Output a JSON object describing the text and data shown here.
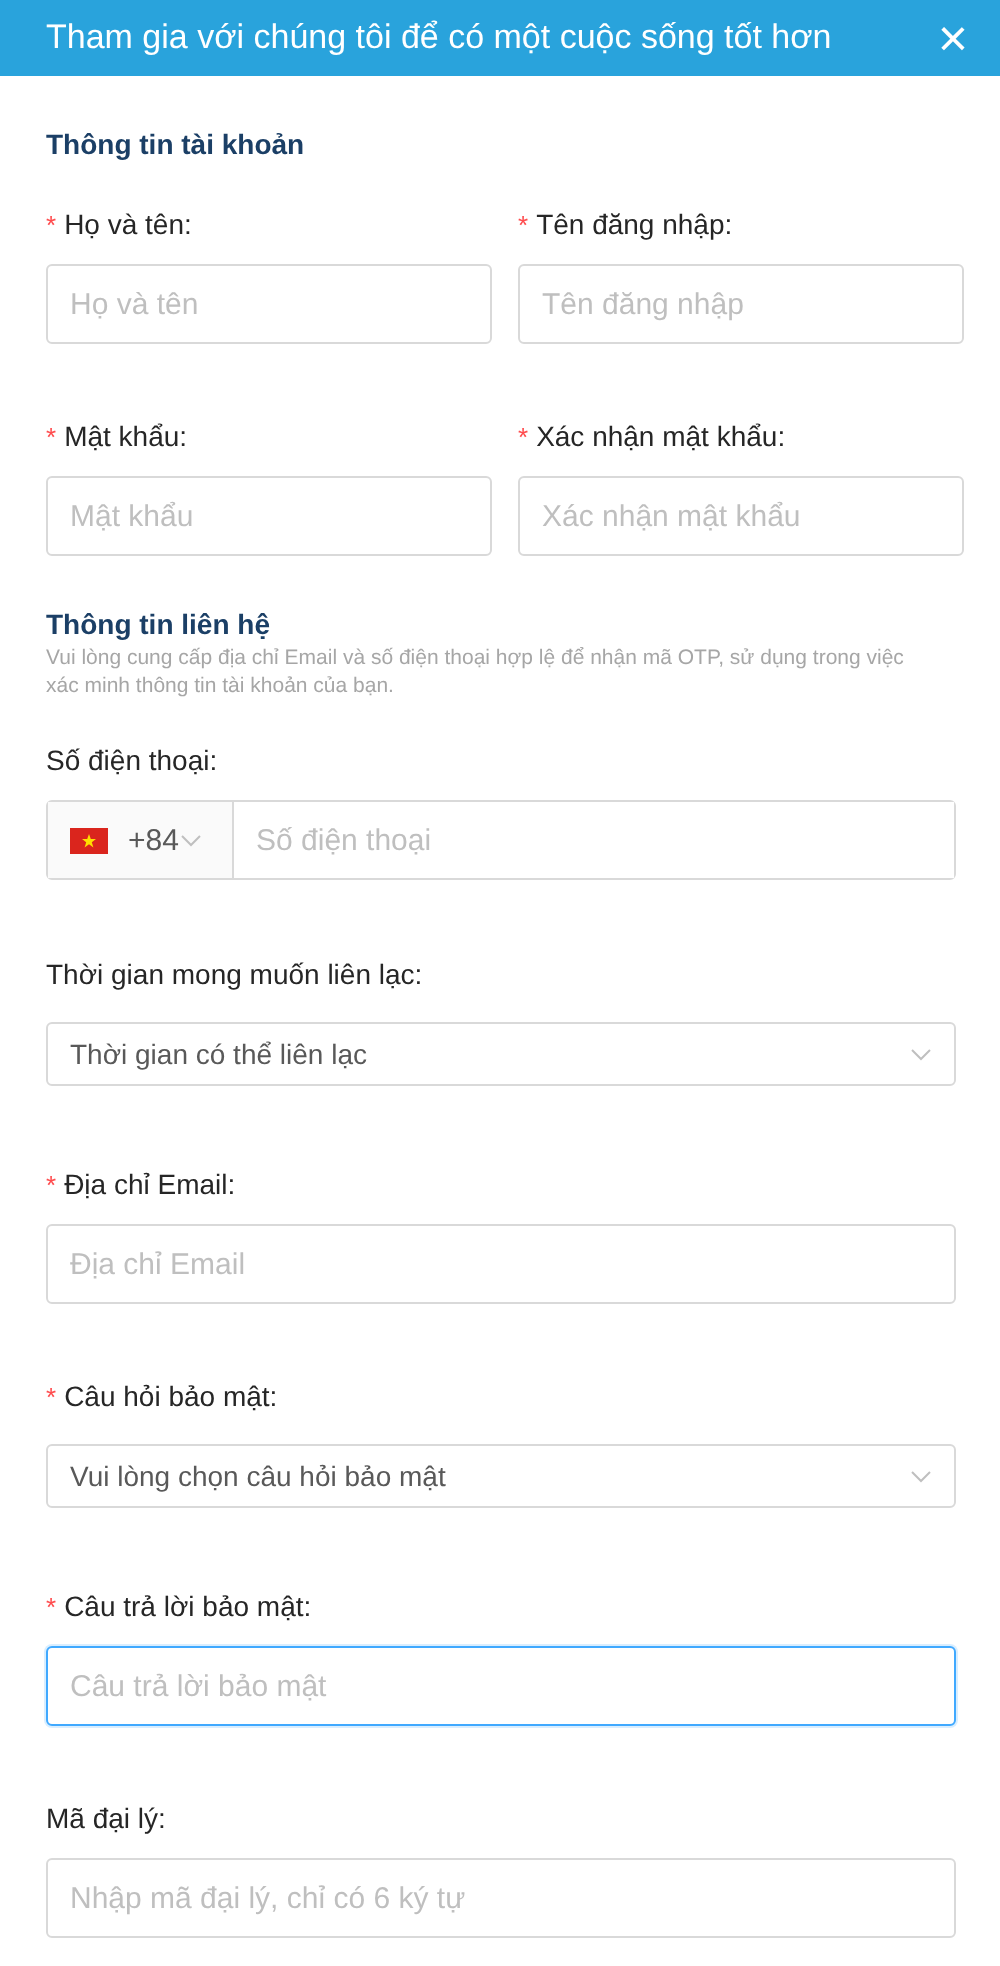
{
  "header": {
    "title": "Tham gia với chúng tôi để có một cuộc sống tốt hơn",
    "close": "×"
  },
  "sections": [
    {
      "title": "Thông tin tài khoản",
      "rows": [
        [
          {
            "kind": "text",
            "mark": "*",
            "label": "Họ và tên:",
            "placeholder": "Họ và tên",
            "focused": false
          },
          {
            "kind": "text",
            "mark": "*",
            "label": "Tên đăng nhập:",
            "placeholder": "Tên đăng nhập",
            "focused": false
          }
        ],
        [
          {
            "kind": "text",
            "mark": "*",
            "label": "Mật khẩu:",
            "placeholder": "Mật khẩu",
            "focused": false
          },
          {
            "kind": "text",
            "mark": "*",
            "label": "Xác nhận mật khẩu:",
            "placeholder": "Xác nhận mật khẩu",
            "focused": false
          }
        ]
      ]
    },
    {
      "title": "Thông tin liên hệ",
      "description": "Vui lòng cung cấp địa chỉ Email và số điện thoại hợp lệ để nhận mã OTP, sử dụng trong việc xác minh thông tin tài khoản của bạn.",
      "rows": [
        [
          {
            "kind": "phone",
            "label": "Số điện thoại:",
            "code": "+84",
            "placeholder": "Số điện thoại",
            "focused": false
          }
        ],
        [
          {
            "kind": "select",
            "label": "Thời gian mong muốn liên lạc:",
            "placeholder": "Thời gian có thể liên lạc",
            "focused": false
          }
        ],
        [
          {
            "kind": "text",
            "mark": "*",
            "label": "Địa chỉ Email:",
            "placeholder": "Địa chỉ Email",
            "focused": false
          }
        ],
        [
          {
            "kind": "select",
            "mark": "*",
            "label": "Câu hỏi bảo mật:",
            "placeholder": "Vui lòng chọn câu hỏi bảo mật",
            "focused": false
          }
        ],
        [
          {
            "kind": "text",
            "mark": "*",
            "label": "Câu trả lời bảo mật:",
            "placeholder": "Câu trả lời bảo mật",
            "focused": true
          }
        ],
        [
          {
            "kind": "text",
            "label": "Mã đại lý:",
            "placeholder": "Nhập mã đại lý, chỉ có 6 ký tự",
            "focused": false
          }
        ]
      ]
    }
  ]
}
